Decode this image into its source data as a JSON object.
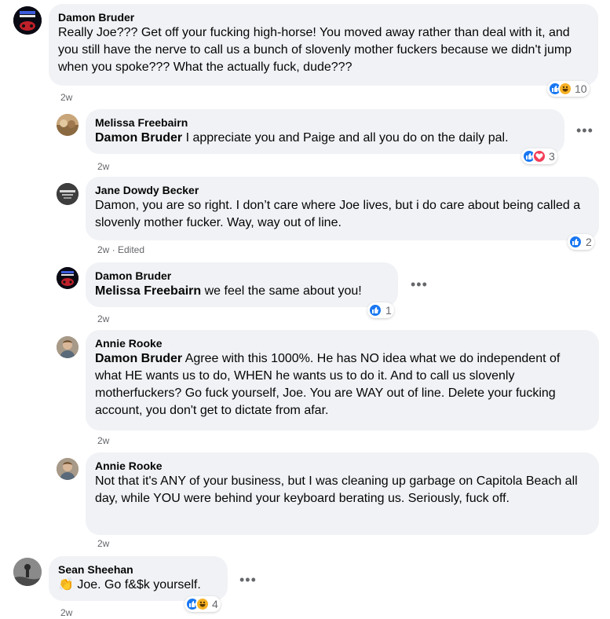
{
  "comments": [
    {
      "author": "Damon Bruder",
      "mention": "",
      "text": "Really Joe??? Get off your fucking high-horse! You moved away rather than deal with it, and you still have the nerve to call us a bunch of slovenly mother fuckers because we didn't jump when you spoke??? What the actually fuck, dude???",
      "time": "2w",
      "reactions": [
        "like",
        "haha"
      ],
      "reaction_count": "10"
    },
    {
      "author": "Melissa Freebairn",
      "mention": "Damon Bruder",
      "text": " I appreciate you and Paige and all you do on the daily pal.",
      "time": "2w",
      "reactions": [
        "like",
        "love"
      ],
      "reaction_count": "3"
    },
    {
      "author": "Jane Dowdy Becker",
      "mention": "",
      "text": "Damon, you are so right. I don’t care where Joe lives, but i do care about being called a slovenly mother fucker. Way, way out of line.",
      "time": "2w · Edited",
      "reactions": [
        "like"
      ],
      "reaction_count": "2"
    },
    {
      "author": "Damon Bruder",
      "mention": "Melissa Freebairn",
      "text": " we feel the same about you!",
      "time": "2w",
      "reactions": [
        "like"
      ],
      "reaction_count": "1"
    },
    {
      "author": "Annie Rooke",
      "mention": "Damon Bruder",
      "text": " Agree with this 1000%. He has NO idea what we do independent of what HE wants us to do, WHEN he wants us to do it. And to call us slovenly motherfuckers? Go fuck yourself, Joe. You are WAY out of line. Delete your fucking account, you don't get to dictate from afar.",
      "time": "2w",
      "reactions": [],
      "reaction_count": ""
    },
    {
      "author": "Annie Rooke",
      "mention": "",
      "text": "Not that it's ANY of your business, but I was cleaning up garbage on Capitola Beach all day, while YOU were behind your keyboard berating us. Seriously, fuck off.",
      "time": "2w",
      "reactions": [],
      "reaction_count": ""
    },
    {
      "author": "Sean Sheehan",
      "mention": "",
      "emoji": "👏",
      "text": " Joe. Go f&$k yourself.",
      "time": "2w",
      "reactions": [
        "like",
        "haha"
      ],
      "reaction_count": "4"
    }
  ],
  "icons": {
    "more": "more-options-icon",
    "like": "like-reaction-icon",
    "haha": "haha-reaction-icon",
    "love": "love-reaction-icon"
  },
  "colors": {
    "bubble": "#f0f2f5",
    "meta": "#65676b",
    "like": "#1877f2",
    "love": "#f33e58",
    "haha": "#f7b125"
  }
}
